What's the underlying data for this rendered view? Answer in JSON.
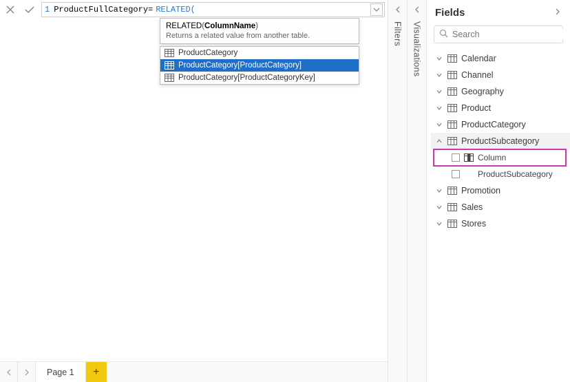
{
  "formula": {
    "lineNumber": "1",
    "beforeFunc": "ProductFullCategory=",
    "funcPart": "RELATED(",
    "tooltip": {
      "funcName": "RELATED",
      "paramName": "ColumnName",
      "description": "Returns a related value from another table."
    },
    "suggestions": [
      {
        "label": "ProductCategory",
        "selected": false
      },
      {
        "label": "ProductCategory[ProductCategory]",
        "selected": true
      },
      {
        "label": "ProductCategory[ProductCategoryKey]",
        "selected": false
      }
    ]
  },
  "panels": {
    "filters": "Filters",
    "visualizations": "Visualizations"
  },
  "pages": {
    "page1": "Page 1"
  },
  "fields": {
    "title": "Fields",
    "searchPlaceholder": "Search",
    "tables": [
      {
        "name": "Calendar",
        "expanded": false
      },
      {
        "name": "Channel",
        "expanded": false
      },
      {
        "name": "Geography",
        "expanded": false
      },
      {
        "name": "Product",
        "expanded": false
      },
      {
        "name": "ProductCategory",
        "expanded": false
      },
      {
        "name": "ProductSubcategory",
        "expanded": true,
        "children": [
          {
            "label": "Column",
            "highlight": true,
            "icon": "column"
          },
          {
            "label": "ProductSubcategory",
            "highlight": false,
            "icon": "none"
          }
        ]
      },
      {
        "name": "Promotion",
        "expanded": false
      },
      {
        "name": "Sales",
        "expanded": false
      },
      {
        "name": "Stores",
        "expanded": false
      }
    ]
  }
}
